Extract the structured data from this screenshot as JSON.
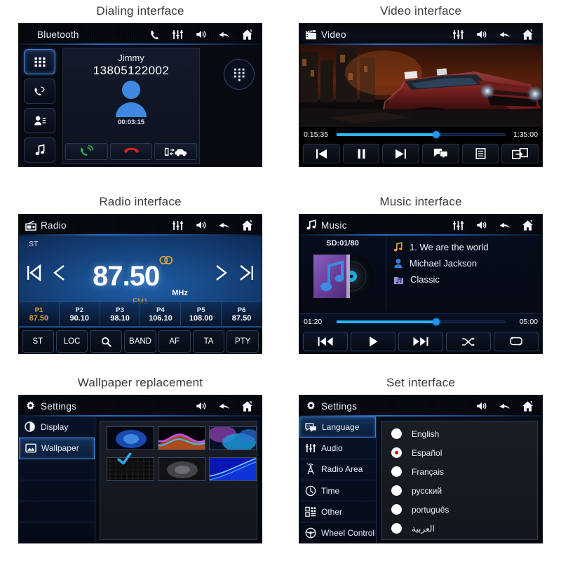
{
  "panels": {
    "dialing": {
      "caption": "Dialing interface",
      "header": {
        "title": "Bluetooth",
        "icons": [
          "phone-icon",
          "equalizer-icon",
          "volume-icon",
          "back-icon",
          "home-icon"
        ]
      },
      "rail": [
        "keypad-icon",
        "call-history-icon",
        "contacts-icon",
        "music-icon"
      ],
      "contact_name": "Jimmy",
      "phone_number": "13805122002",
      "call_timer": "00:03:15",
      "actions": [
        "answer-call-icon",
        "end-call-icon",
        "transfer-audio-icon"
      ],
      "keypad_button": "keypad-icon"
    },
    "video": {
      "caption": "Video interface",
      "header": {
        "icon": "clapperboard-icon",
        "title": "Video",
        "icons": [
          "equalizer-icon",
          "volume-icon",
          "back-icon",
          "home-icon"
        ]
      },
      "elapsed": "0:15:35",
      "duration": "1:35:00",
      "progress_percent": 59,
      "controls": [
        "previous-icon",
        "pause-icon",
        "next-icon",
        "subtitles-icon",
        "playlist-icon",
        "screen-share-icon"
      ]
    },
    "radio": {
      "caption": "Radio interface",
      "header": {
        "icon": "radio-icon",
        "title": "Radio",
        "icons": [
          "equalizer-icon",
          "volume-icon",
          "back-icon",
          "home-icon"
        ]
      },
      "stereo_indicator": "ST",
      "frequency": "87.50",
      "unit": "MHz",
      "band": "FM1",
      "stereo_ring": "∞",
      "presets": [
        {
          "name": "P1",
          "value": "87.50",
          "active": true
        },
        {
          "name": "P2",
          "value": "90.10",
          "active": false
        },
        {
          "name": "P3",
          "value": "98.10",
          "active": false
        },
        {
          "name": "P4",
          "value": "106.10",
          "active": false
        },
        {
          "name": "P5",
          "value": "108.00",
          "active": false
        },
        {
          "name": "P6",
          "value": "87.50",
          "active": false
        }
      ],
      "buttons": [
        "ST",
        "LOC",
        "search-icon",
        "BAND",
        "AF",
        "TA",
        "PTY"
      ],
      "accent": "#d9a23c"
    },
    "music": {
      "caption": "Music interface",
      "header": {
        "icon": "music-note-icon",
        "title": "Music",
        "icons": [
          "equalizer-icon",
          "volume-icon",
          "back-icon",
          "home-icon"
        ]
      },
      "source": "SD:01/80",
      "track": "1.  We are the world",
      "artist": "Michael Jackson",
      "album": "Classic",
      "elapsed": "01:20",
      "duration": "05:00",
      "progress_percent": 59,
      "controls": [
        "previous-track-icon",
        "play-icon",
        "next-track-icon",
        "shuffle-icon",
        "repeat-icon"
      ]
    },
    "wallpaper": {
      "caption": "Wallpaper replacement",
      "header": {
        "icon": "gear-icon",
        "title": "Settings",
        "icons": [
          "volume-icon",
          "back-icon",
          "home-icon"
        ]
      },
      "menu": [
        {
          "label": "Display",
          "icon": "contrast-icon",
          "active": false
        },
        {
          "label": "Wallpaper",
          "icon": "image-icon",
          "active": true
        },
        {
          "label": "",
          "icon": "",
          "active": false
        },
        {
          "label": "",
          "icon": "",
          "active": false
        },
        {
          "label": "",
          "icon": "",
          "active": false
        },
        {
          "label": "",
          "icon": "",
          "active": false
        }
      ],
      "thumbs": [
        "blue-glow",
        "neon-waves",
        "cyan-blur",
        "dark-grid",
        "grey-mist",
        "blue-streak"
      ],
      "selected_index": 0
    },
    "settings": {
      "caption": "Set interface",
      "header": {
        "icon": "gear-icon",
        "title": "Settings",
        "icons": [
          "volume-icon",
          "back-icon",
          "home-icon"
        ]
      },
      "menu": [
        {
          "label": "Language",
          "icon": "speech-bubble-icon",
          "active": true
        },
        {
          "label": "Audio",
          "icon": "equalizer-icon",
          "active": false
        },
        {
          "label": "Radio Area",
          "icon": "antenna-icon",
          "active": false
        },
        {
          "label": "Time",
          "icon": "clock-icon",
          "active": false
        },
        {
          "label": "Other",
          "icon": "grid-list-icon",
          "active": false
        },
        {
          "label": "Wheel Control",
          "icon": "steering-wheel-icon",
          "active": false
        }
      ],
      "languages": [
        {
          "label": "English",
          "selected": false
        },
        {
          "label": "Español",
          "selected": true
        },
        {
          "label": "Français",
          "selected": false
        },
        {
          "label": "русский",
          "selected": false
        },
        {
          "label": "português",
          "selected": false
        },
        {
          "label": "العربية",
          "selected": false
        }
      ],
      "selected_color": "#d80000"
    }
  }
}
